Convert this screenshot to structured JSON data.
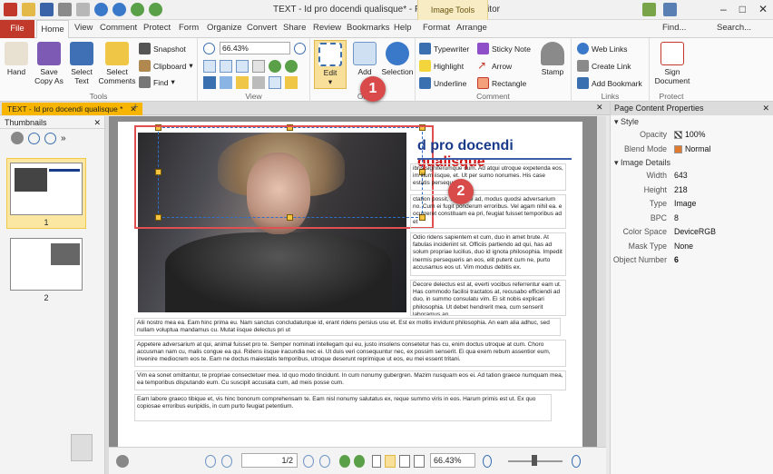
{
  "app": {
    "title": "TEXT - Id pro docendi qualisque* - PDF-XChange Editor",
    "context_group": "Image Tools"
  },
  "tabs": [
    "File",
    "Home",
    "View",
    "Comment",
    "Protect",
    "Form",
    "Organize",
    "Convert",
    "Share",
    "Review",
    "Bookmarks",
    "Help",
    "Format",
    "Arrange"
  ],
  "top_right": {
    "find": "Find...",
    "search": "Search..."
  },
  "ribbon": {
    "tools": {
      "label": "Tools",
      "hand": "Hand",
      "save_copy": "Save Copy As",
      "select_text": "Select Text",
      "select_comments": "Select Comments",
      "snapshot": "Snapshot",
      "clipboard": "Clipboard",
      "find": "Find"
    },
    "view": {
      "label": "View",
      "zoom": "66.43%"
    },
    "objects": {
      "edit": "Edit",
      "add": "Add",
      "selection": "Selection",
      "label": "Ob"
    },
    "comment": {
      "label": "Comment",
      "typewriter": "Typewriter",
      "sticky_note": "Sticky Note",
      "highlight": "Highlight",
      "arrow": "Arrow",
      "underline": "Underline",
      "rectangle": "Rectangle",
      "stamp": "Stamp"
    },
    "links": {
      "label": "Links",
      "web_links": "Web Links",
      "create_link": "Create Link",
      "add_bookmark": "Add Bookmark"
    },
    "protect": {
      "label": "Protect",
      "sign": "Sign Document"
    }
  },
  "document_tab": "TEXT - Id pro docendi qualisque *",
  "thumbnails": {
    "title": "Thumbnails",
    "pages": [
      "1",
      "2"
    ]
  },
  "page": {
    "title_blue": "d pro docendi ",
    "title_red": "qualisque",
    "paragraphs": [
      "ibris signiferumque cum. Ad atqui utroque expetenda eos, im illum iisque, et. Ut per sumo nonumes. His case estatis persequer",
      "ctation possit, sonet ue ad, modus quodsi adversarium no. Cum ei fugit ponderum erroribus. Vel agam nihil ea. e ocurreret constituam ea pri, feugiat fuisset temporibus ad et",
      "Odio ridens sapientem et cum, duo in amet brute. At fabulas incideriint sit. Officiis partiendo ad qui, has ad solum propriae lucilius, duo id ignota philosophia. Impedit inermis persequeris an eos, elit putent cum ne, purto accusamus eos ut. Vim modus debitis ex.",
      "Decore delectus est at, everti vocibus referrentur eam ut. Has commodo facilisi tractatos at, recusabo efficiendi ad duo, in summo consulatu vim. Ei sit nobis explicari philosophia. Ut debet hendrerit mea, cum senserit laboramus an.",
      "Alii nostro mea ea. Eam hinc prima eu. Nam sanctus concludaturque id, erant ridens persius usu et. Est ex mollis invidunt philosophia. An eam alia adhuc, sed nullam voluptua mandamus cu. Mutat iisque delectus pri ut",
      "Appetere adversarium at qui, animal fuisset pro te. Semper nominati intellegam qui eu, justo insolens consetetur has cu, enim doctus utroque at cum. Choro accusman nam cu, malis congue ea qui. Ridens iisque iracundia nec ei. Ut duis veri consequuntur nec, ex possim senserit. Ei qua exem rebum assentior eum, invenire mediocrem eos te. Eam ne doctus maiestatis temporibus, utroque deserunt reprimique ut eos, eu mei essent tritani.",
      "Vim ea sonet omittantur, te propriae consectetuer mea. Id quo modo tincidunt. In cum nonumy gubergren. Mazim nusquam eos ei. Ad tation graece numquam mea, ea temporibus disputando eum. Cu suscipit accusata cum, ad meis posse cum.",
      "Eam labore graeco tibique et, vis hinc bonorum comprehensam te. Eam nisl nonumy salutatus ex, reque summo viris in eos. Harum primis est ut. Ex quo copiosae erroribus euripidis, in cum purto feugiat petentium."
    ]
  },
  "status": {
    "page": "1/2",
    "zoom": "66.43%"
  },
  "properties": {
    "title": "Page Content Properties",
    "style_section": "Style",
    "opacity_label": "Opacity",
    "opacity": "100%",
    "blend_label": "Blend Mode",
    "blend": "Normal",
    "image_section": "Image Details",
    "rows": [
      {
        "k": "Width",
        "v": "643"
      },
      {
        "k": "Height",
        "v": "218"
      },
      {
        "k": "Type",
        "v": "Image"
      },
      {
        "k": "BPC",
        "v": "8"
      },
      {
        "k": "Color Space",
        "v": "DeviceRGB"
      },
      {
        "k": "Mask Type",
        "v": "None"
      },
      {
        "k": "Object Number",
        "v": "6"
      }
    ]
  },
  "callouts": [
    "1",
    "2"
  ]
}
